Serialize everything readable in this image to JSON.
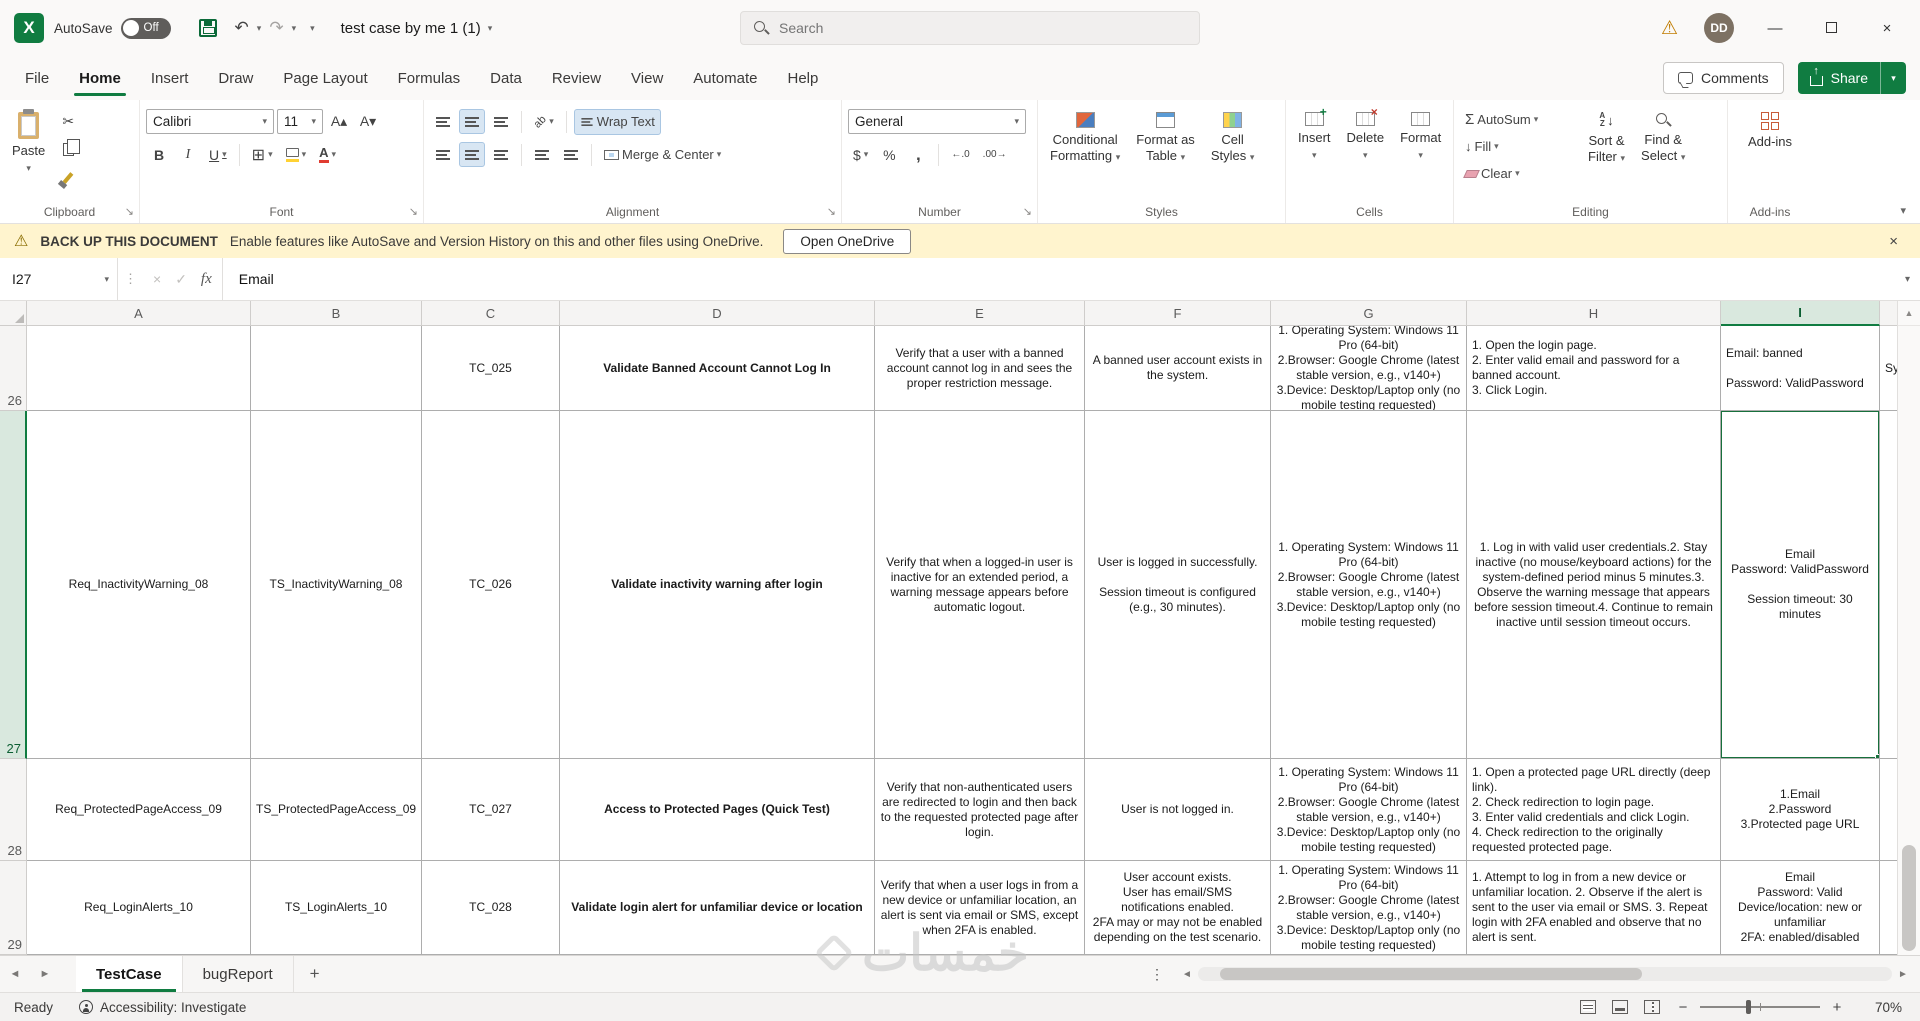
{
  "title_bar": {
    "autosave_label": "AutoSave",
    "autosave_state": "Off",
    "file_name": "test case by me 1 (1)",
    "search_placeholder": "Search",
    "avatar_initials": "DD"
  },
  "ribbon_tabs": {
    "items": [
      {
        "label": "File"
      },
      {
        "label": "Home"
      },
      {
        "label": "Insert"
      },
      {
        "label": "Draw"
      },
      {
        "label": "Page Layout"
      },
      {
        "label": "Formulas"
      },
      {
        "label": "Data"
      },
      {
        "label": "Review"
      },
      {
        "label": "View"
      },
      {
        "label": "Automate"
      },
      {
        "label": "Help"
      }
    ],
    "active": "Home",
    "comments_label": "Comments",
    "share_label": "Share"
  },
  "ribbon": {
    "icons": {
      "bold": "B",
      "italic": "I",
      "underline": "U",
      "sigma": "Σ",
      "dollar": "$",
      "percent": "%",
      "comma": ",",
      "inc_decimal": "←.0",
      "dec_decimal": ".00→",
      "az": "AZ",
      "arrow_down": "↓",
      "wrap_arrow": "↩",
      "scissors": "✂",
      "borders": "⊞",
      "font_a": "A",
      "grow_a": "A▴",
      "shrink_a": "A▾"
    },
    "clipboard": {
      "group_label": "Clipboard",
      "paste_label": "Paste"
    },
    "font": {
      "group_label": "Font",
      "font_name": "Calibri",
      "font_size": "11"
    },
    "alignment": {
      "group_label": "Alignment",
      "wrap_text_label": "Wrap Text",
      "merge_center_label": "Merge & Center"
    },
    "number": {
      "group_label": "Number",
      "format_value": "General"
    },
    "styles": {
      "group_label": "Styles",
      "conditional_1": "Conditional",
      "conditional_2": "Formatting",
      "format_table_1": "Format as",
      "format_table_2": "Table",
      "cell_styles_1": "Cell",
      "cell_styles_2": "Styles"
    },
    "cells": {
      "group_label": "Cells",
      "insert_label": "Insert",
      "delete_label": "Delete",
      "format_label": "Format"
    },
    "editing": {
      "group_label": "Editing",
      "autosum_label": "AutoSum",
      "fill_label": "Fill",
      "clear_label": "Clear",
      "sort_1": "Sort &",
      "sort_2": "Filter",
      "find_1": "Find &",
      "find_2": "Select"
    },
    "addins": {
      "group_label": "Add-ins",
      "button_label": "Add-ins"
    }
  },
  "notice_bar": {
    "title": "BACK UP THIS DOCUMENT",
    "message": "Enable features like AutoSave and Version History on this and other files using OneDrive.",
    "action_label": "Open OneDrive"
  },
  "formula_bar": {
    "name_box": "I27",
    "fx_label": "fx",
    "content": "Email"
  },
  "sheet": {
    "columns": [
      "A",
      "B",
      "C",
      "D",
      "E",
      "F",
      "G",
      "H",
      "I"
    ],
    "selected": {
      "col": "I",
      "row": "27"
    },
    "rows": [
      {
        "num": "26",
        "cells": [
          "",
          "",
          "TC_025",
          "Validate Banned Account Cannot Log In",
          "Verify that a user with a banned account cannot log in and sees the proper restriction message.",
          "A banned user account exists in the system.",
          "1. Operating System: Windows 11 Pro (64-bit)\n2.Browser: Google Chrome (latest stable version, e.g., v140+)\n3.Device: Desktop/Laptop only (no mobile testing requested)",
          "1. Open the login page.\n2. Enter valid email and password for a banned account.\n3. Click Login.",
          "Email: banned\n\nPassword: ValidPassword"
        ],
        "overflow": "Sy"
      },
      {
        "num": "27",
        "cells": [
          "Req_InactivityWarning_08",
          "TS_InactivityWarning_08",
          "TC_026",
          "Validate inactivity warning after login",
          "Verify that when a logged-in user is inactive for an extended period, a warning message appears before automatic logout.",
          "User is logged in successfully.\n\nSession timeout is configured (e.g., 30 minutes).",
          "1. Operating System: Windows 11 Pro (64-bit)\n2.Browser: Google Chrome (latest stable version, e.g., v140+)\n3.Device: Desktop/Laptop only (no mobile testing requested)",
          "1. Log in with valid user credentials.2. Stay inactive (no mouse/keyboard actions) for the system-defined period minus 5 minutes.3. Observe the warning message that appears before session timeout.4. Continue to remain inactive until session timeout occurs.",
          "Email\nPassword: ValidPassword\n\nSession timeout: 30 minutes"
        ],
        "overflow": ""
      },
      {
        "num": "28",
        "cells": [
          "Req_ProtectedPageAccess_09",
          "TS_ProtectedPageAccess_09",
          "TC_027",
          "Access to Protected Pages (Quick Test)",
          "Verify that non-authenticated users are redirected to login and then back to the requested protected page after login.",
          "User is not logged in.",
          "1. Operating System: Windows 11 Pro (64-bit)\n2.Browser: Google Chrome (latest stable version, e.g., v140+)\n3.Device: Desktop/Laptop only (no mobile testing requested)",
          "1. Open a protected page URL directly (deep link).\n2. Check redirection to login page.\n3. Enter valid credentials and click Login.\n4. Check redirection to the originally requested protected page.",
          "1.Email\n2.Password\n3.Protected page URL"
        ],
        "overflow": ""
      },
      {
        "num": "29",
        "cells": [
          "Req_LoginAlerts_10",
          "TS_LoginAlerts_10",
          "TC_028",
          "Validate login alert for unfamiliar device or location",
          "Verify that when a user logs in from a new device or unfamiliar location, an alert is sent via email or SMS, except when 2FA is enabled.",
          "User account exists.\nUser has email/SMS notifications enabled.\n2FA may or may not be enabled depending on the test scenario.",
          "1. Operating System: Windows 11 Pro (64-bit)\n2.Browser: Google Chrome (latest stable version, e.g., v140+)\n3.Device: Desktop/Laptop only (no mobile testing requested)",
          "1. Attempt to log in from a new device or unfamiliar location. 2. Observe if the alert is sent to the user via email or SMS. 3. Repeat login with 2FA enabled and observe that no alert is sent.",
          "Email\nPassword: Valid\nDevice/location: new or unfamiliar\n2FA: enabled/disabled"
        ],
        "overflow": ""
      }
    ]
  },
  "sheet_tabs": {
    "items": [
      {
        "label": "TestCase"
      },
      {
        "label": "bugReport"
      }
    ],
    "active": "TestCase"
  },
  "status_bar": {
    "ready_label": "Ready",
    "accessibility_label": "Accessibility: Investigate",
    "zoom_level": "70%"
  },
  "watermark": {
    "text": "خمسات"
  },
  "colors": {
    "excel_green": "#107C41",
    "notice_yellow": "#FFF4CE",
    "selection_green": "#17703C"
  }
}
